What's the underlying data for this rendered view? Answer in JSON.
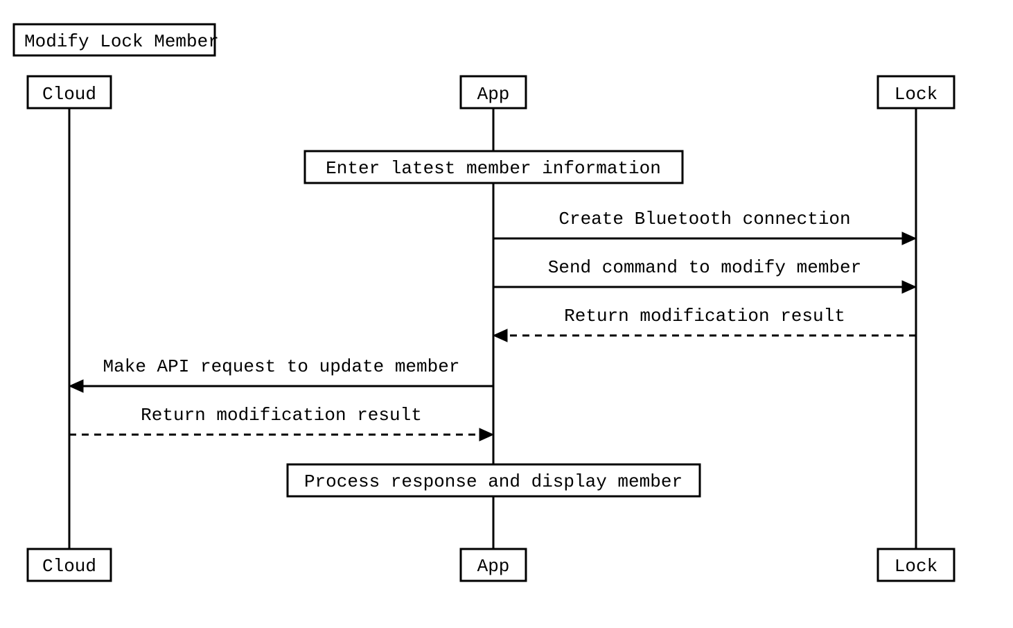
{
  "diagram": {
    "title": "Modify Lock Member",
    "participants": {
      "cloud": "Cloud",
      "app": "App",
      "lock": "Lock"
    },
    "notes": {
      "enter_info": "Enter latest member information",
      "process_response": "Process response and display member"
    },
    "messages": {
      "bt_connect": "Create Bluetooth connection",
      "send_modify": "Send command to modify member",
      "return_mod_result_lock": "Return modification result",
      "api_update": "Make API request to update member",
      "return_mod_result_cloud": "Return modification result"
    }
  }
}
